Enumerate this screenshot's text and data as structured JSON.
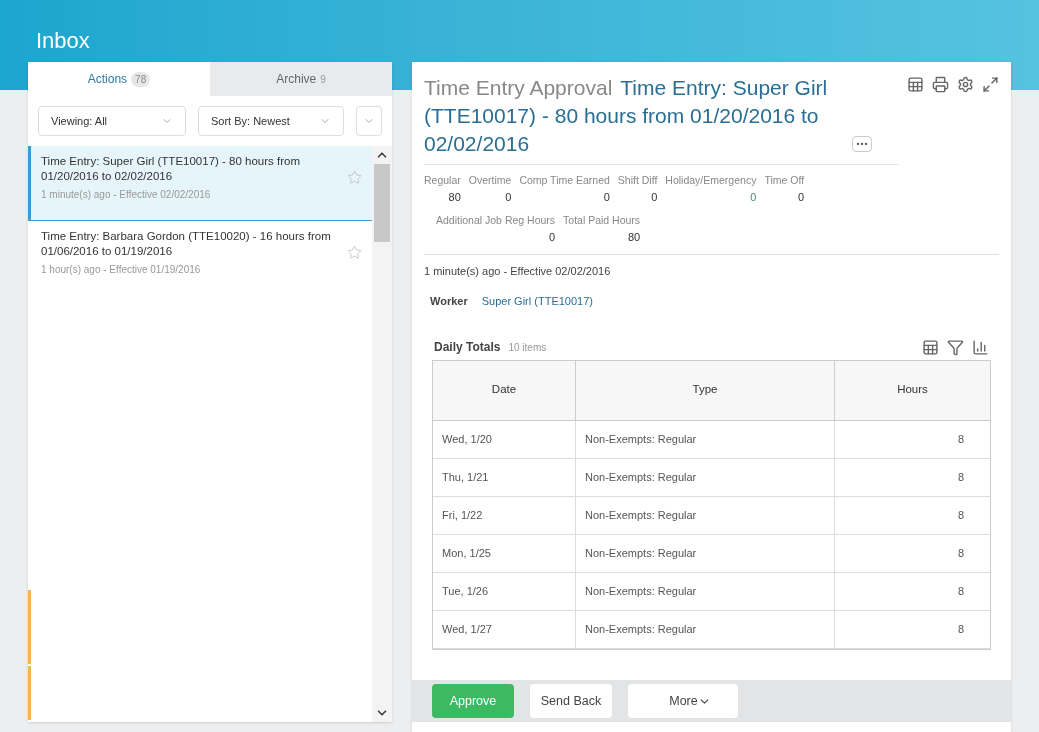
{
  "page_title": "Inbox",
  "tabs": [
    {
      "label": "Actions",
      "count": "78",
      "selected": true
    },
    {
      "label": "Archive",
      "count": "9",
      "selected": false
    }
  ],
  "filters": [
    {
      "label": "Viewing: All"
    },
    {
      "label": "Sort By: Newest"
    }
  ],
  "inbox_items": [
    {
      "title": "Time Entry: Super Girl (TTE10017) - 80 hours from 01/20/2016 to 02/02/2016",
      "meta": "1 minute(s) ago - Effective 02/02/2016",
      "selected": true
    },
    {
      "title": "Time Entry: Barbara Gordon (TTE10020) - 16 hours from 01/06/2016 to 01/19/2016",
      "meta": "1 hour(s) ago - Effective 01/19/2016",
      "selected": false
    }
  ],
  "detail": {
    "heading": "Time Entry Approval",
    "subject": "Time Entry: Super Girl (TTE10017) - 80 hours from 01/20/2016 to 02/02/2016",
    "stats": [
      [
        {
          "label": "Regular",
          "value": "80",
          "link": false
        },
        {
          "label": "Overtime",
          "value": "0",
          "link": false
        },
        {
          "label": "Comp Time Earned",
          "value": "0",
          "link": false
        },
        {
          "label": "Shift Diff",
          "value": "0",
          "link": false
        },
        {
          "label": "Holiday/Emergency",
          "value": "0",
          "link": true
        },
        {
          "label": "Time Off",
          "value": "0",
          "link": false
        }
      ],
      [
        {
          "label": "Additional Job Reg Hours",
          "value": "0",
          "link": false
        },
        {
          "label": "Total Paid Hours",
          "value": "80",
          "link": false
        }
      ]
    ],
    "effective": "1 minute(s) ago - Effective 02/02/2016",
    "worker_label": "Worker",
    "worker": "Super Girl (TTE10017)",
    "table_title": "Daily Totals",
    "table_count": "10 items",
    "columns": [
      "Date",
      "Type",
      "Hours"
    ],
    "rows": [
      [
        "Wed, 1/20",
        "Non-Exempts: Regular",
        "8"
      ],
      [
        "Thu, 1/21",
        "Non-Exempts: Regular",
        "8"
      ],
      [
        "Fri, 1/22",
        "Non-Exempts: Regular",
        "8"
      ],
      [
        "Mon, 1/25",
        "Non-Exempts: Regular",
        "8"
      ],
      [
        "Tue, 1/26",
        "Non-Exempts: Regular",
        "8"
      ],
      [
        "Wed, 1/27",
        "Non-Exempts: Regular",
        "8"
      ]
    ]
  },
  "actions": [
    {
      "label": "Approve",
      "kind": "primary"
    },
    {
      "label": "Send Back",
      "kind": "secondary"
    },
    {
      "label": "More",
      "kind": "menu"
    }
  ]
}
